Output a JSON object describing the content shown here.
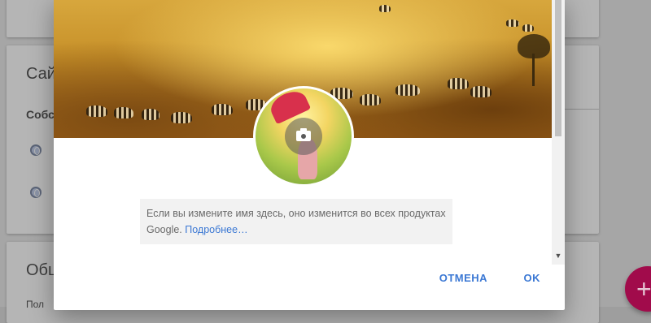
{
  "background_page": {
    "section1_title": "Сай",
    "section1_subtitle": "Собс",
    "section2_title": "Общ",
    "section2_subtitle": "Пол"
  },
  "dialog": {
    "cover_image": "savanna-zebras-photo",
    "avatar_image": "woman-with-red-umbrella-photo",
    "camera_icon": "camera-icon",
    "note": {
      "text": "Если вы измените имя здесь, оно изменится во всех продуктах Google.",
      "link": "Подробнее…"
    },
    "cancel_label": "ОТМЕНА",
    "ok_label": "OK"
  },
  "fab": {
    "icon": "plus-icon",
    "label": "+"
  },
  "colors": {
    "accent": "#3b78d4",
    "fab": "#a10b4b"
  }
}
